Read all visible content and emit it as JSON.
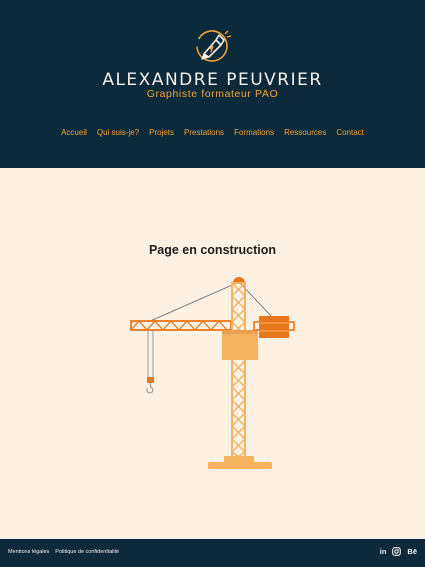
{
  "header": {
    "logo_icon": "pen-tablet-logo-icon",
    "brand": "ALEXANDRE PEUVRIER",
    "tagline": "Graphiste formateur PAO",
    "nav": [
      "Accueil",
      "Qui suis-je?",
      "Projets",
      "Prestations",
      "Formations",
      "Ressources",
      "Contact"
    ]
  },
  "main": {
    "title": "Page en construction",
    "illustration_icon": "crane-icon"
  },
  "footer": {
    "links": [
      "Mentions légales",
      "Politique de confidentialité"
    ],
    "social": {
      "linkedin": "in",
      "instagram_icon": "instagram-icon",
      "behance": "Bē"
    }
  },
  "colors": {
    "header_bg": "#0d2a3a",
    "page_bg": "#fdf1e3",
    "accent": "#f4a23a",
    "crane_dark": "#e8761a",
    "crane_light": "#f6b35f"
  }
}
